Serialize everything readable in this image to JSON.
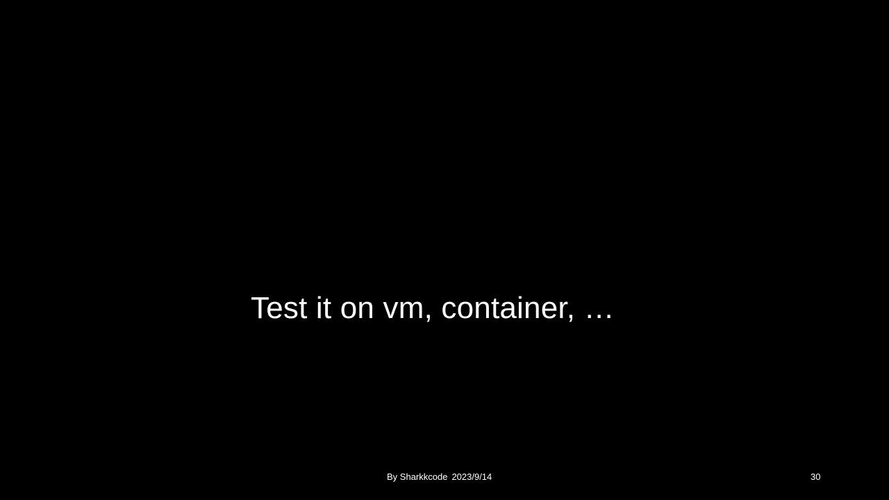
{
  "slide": {
    "title": "Test it on vm, container, …",
    "footer": {
      "author": "By Sharkkcode",
      "date": "2023/9/14"
    },
    "slide_number": "30"
  },
  "colors": {
    "background": "#000000",
    "text": "#ffffff"
  }
}
